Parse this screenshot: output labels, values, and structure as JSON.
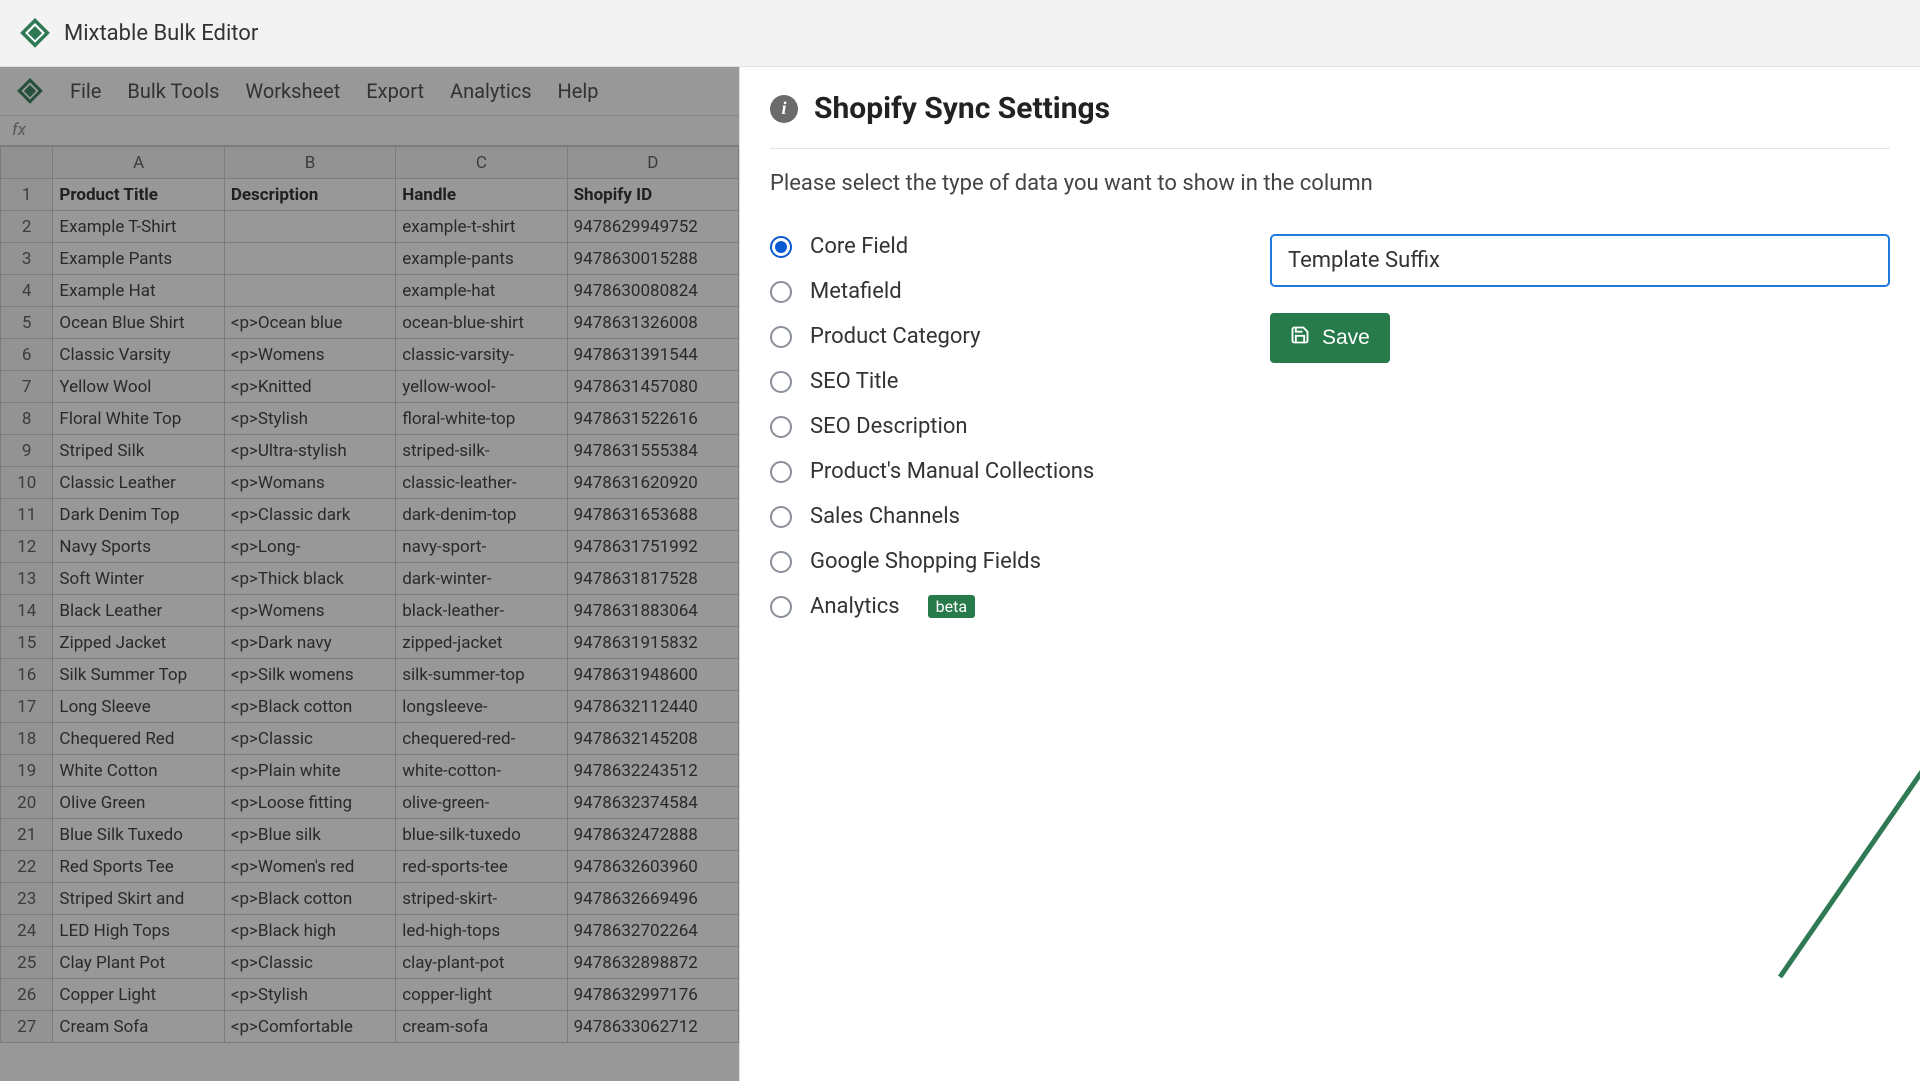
{
  "app": {
    "title": "Mixtable Bulk Editor"
  },
  "menu": {
    "items": [
      "File",
      "Bulk Tools",
      "Worksheet",
      "Export",
      "Analytics",
      "Help"
    ]
  },
  "formula_prefix": "fx",
  "sheet": {
    "columns": [
      "A",
      "B",
      "C",
      "D"
    ],
    "headers": [
      "Product Title",
      "Description",
      "Handle",
      "Shopify ID"
    ],
    "rows": [
      {
        "n": 2,
        "a": "Example T-Shirt",
        "b": "",
        "c": "example-t-shirt",
        "d": "9478629949752"
      },
      {
        "n": 3,
        "a": "Example Pants",
        "b": "",
        "c": "example-pants",
        "d": "9478630015288"
      },
      {
        "n": 4,
        "a": "Example Hat",
        "b": "",
        "c": "example-hat",
        "d": "9478630080824"
      },
      {
        "n": 5,
        "a": "Ocean Blue Shirt",
        "b": "<p>Ocean blue",
        "c": "ocean-blue-shirt",
        "d": "9478631326008"
      },
      {
        "n": 6,
        "a": "Classic Varsity",
        "b": "<p>Womens",
        "c": "classic-varsity-",
        "d": "9478631391544"
      },
      {
        "n": 7,
        "a": "Yellow Wool",
        "b": "<p>Knitted",
        "c": "yellow-wool-",
        "d": "9478631457080"
      },
      {
        "n": 8,
        "a": "Floral White Top",
        "b": "<p>Stylish",
        "c": "floral-white-top",
        "d": "9478631522616"
      },
      {
        "n": 9,
        "a": "Striped Silk",
        "b": "<p>Ultra-stylish",
        "c": "striped-silk-",
        "d": "9478631555384"
      },
      {
        "n": 10,
        "a": "Classic Leather",
        "b": "<p>Womans",
        "c": "classic-leather-",
        "d": "9478631620920"
      },
      {
        "n": 11,
        "a": "Dark Denim Top",
        "b": "<p>Classic dark",
        "c": "dark-denim-top",
        "d": "9478631653688"
      },
      {
        "n": 12,
        "a": "Navy Sports",
        "b": "<p>Long-",
        "c": "navy-sport-",
        "d": "9478631751992"
      },
      {
        "n": 13,
        "a": "Soft Winter",
        "b": "<p>Thick black",
        "c": "dark-winter-",
        "d": "9478631817528"
      },
      {
        "n": 14,
        "a": "Black Leather",
        "b": "<p>Womens",
        "c": "black-leather-",
        "d": "9478631883064"
      },
      {
        "n": 15,
        "a": "Zipped Jacket",
        "b": "<p>Dark navy",
        "c": "zipped-jacket",
        "d": "9478631915832"
      },
      {
        "n": 16,
        "a": "Silk Summer Top",
        "b": "<p>Silk womens",
        "c": "silk-summer-top",
        "d": "9478631948600"
      },
      {
        "n": 17,
        "a": "Long Sleeve",
        "b": "<p>Black cotton",
        "c": "longsleeve-",
        "d": "9478632112440"
      },
      {
        "n": 18,
        "a": "Chequered Red",
        "b": "<p>Classic",
        "c": "chequered-red-",
        "d": "9478632145208"
      },
      {
        "n": 19,
        "a": "White Cotton",
        "b": "<p>Plain white",
        "c": "white-cotton-",
        "d": "9478632243512"
      },
      {
        "n": 20,
        "a": "Olive Green",
        "b": "<p>Loose fitting",
        "c": "olive-green-",
        "d": "9478632374584"
      },
      {
        "n": 21,
        "a": "Blue Silk Tuxedo",
        "b": "<p>Blue silk",
        "c": "blue-silk-tuxedo",
        "d": "9478632472888"
      },
      {
        "n": 22,
        "a": "Red Sports Tee",
        "b": "<p>Women's red",
        "c": "red-sports-tee",
        "d": "9478632603960"
      },
      {
        "n": 23,
        "a": "Striped Skirt and",
        "b": "<p>Black cotton",
        "c": "striped-skirt-",
        "d": "9478632669496"
      },
      {
        "n": 24,
        "a": "LED High Tops",
        "b": "<p>Black high",
        "c": "led-high-tops",
        "d": "9478632702264"
      },
      {
        "n": 25,
        "a": "Clay Plant Pot",
        "b": "<p>Classic",
        "c": "clay-plant-pot",
        "d": "9478632898872"
      },
      {
        "n": 26,
        "a": "Copper Light",
        "b": "<p>Stylish",
        "c": "copper-light",
        "d": "9478632997176"
      },
      {
        "n": 27,
        "a": "Cream Sofa",
        "b": "<p>Comfortable",
        "c": "cream-sofa",
        "d": "9478633062712"
      }
    ]
  },
  "panel": {
    "title": "Shopify Sync Settings",
    "description": "Please select the type of data you want to show in the column",
    "radios": [
      {
        "label": "Core Field",
        "selected": true
      },
      {
        "label": "Metafield",
        "selected": false
      },
      {
        "label": "Product Category",
        "selected": false
      },
      {
        "label": "SEO Title",
        "selected": false
      },
      {
        "label": "SEO Description",
        "selected": false
      },
      {
        "label": "Product's Manual Collections",
        "selected": false
      },
      {
        "label": "Sales Channels",
        "selected": false
      },
      {
        "label": "Google Shopping Fields",
        "selected": false
      },
      {
        "label": "Analytics",
        "selected": false,
        "badge": "beta"
      }
    ],
    "select_value": "Template Suffix",
    "save_label": "Save",
    "info_char": "i"
  }
}
